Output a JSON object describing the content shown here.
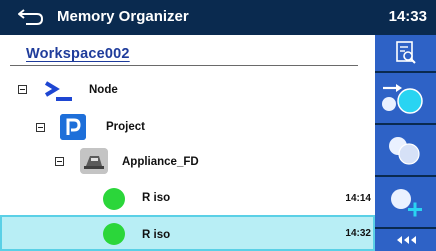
{
  "header": {
    "title": "Memory Organizer",
    "clock": "14:33",
    "back_icon": "back-arrow-icon"
  },
  "workspace": {
    "name": "Workspace002"
  },
  "tree": {
    "node": {
      "label": "Node",
      "icon": "node-prompt-icon"
    },
    "project": {
      "label": "Project",
      "icon": "project-icon"
    },
    "appliance": {
      "label": "Appliance_FD",
      "icon": "appliance-icon"
    },
    "measurements": [
      {
        "label": "R iso",
        "time": "14:14",
        "status_color": "#2bd63a"
      },
      {
        "label": "R iso",
        "time": "14:32",
        "status_color": "#2bd63a",
        "selected": true
      }
    ]
  },
  "sidebar": {
    "buttons": [
      {
        "icon": "view-document-icon"
      },
      {
        "icon": "start-test-icon"
      },
      {
        "icon": "clone-icon"
      },
      {
        "icon": "add-icon"
      },
      {
        "icon": "more-options-icon",
        "label": "◂◂◂"
      }
    ]
  },
  "colors": {
    "header_bg": "#0a2a4f",
    "sidebar_button": "#2e62c6",
    "selection_bg": "#b8eef5",
    "selection_border": "#5ad0e6",
    "workspace_text": "#1f3c9b",
    "status_ok": "#2bd63a"
  }
}
